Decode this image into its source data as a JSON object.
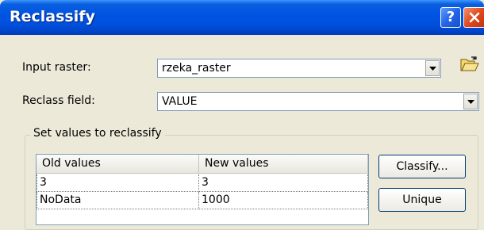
{
  "window": {
    "title": "Reclassify",
    "help_glyph": "?"
  },
  "input_raster": {
    "label": "Input raster:",
    "value": "rzeka_raster"
  },
  "reclass_field": {
    "label": "Reclass field:",
    "value": "VALUE"
  },
  "reclassify_group": {
    "legend": "Set values to reclassify",
    "columns": [
      "Old values",
      "New values"
    ],
    "rows": [
      {
        "old": "3",
        "new": "3"
      },
      {
        "old": "NoData",
        "new": "1000"
      }
    ],
    "buttons": {
      "classify": "Classify...",
      "unique": "Unique"
    }
  },
  "icons": {
    "help": "help-icon",
    "close": "close-icon",
    "dropdown": "chevron-down-icon",
    "browse": "folder-open-icon"
  },
  "colors": {
    "titlebar": "#0054e3",
    "close_button": "#e04a1e",
    "dialog_bg": "#ece9d8"
  }
}
